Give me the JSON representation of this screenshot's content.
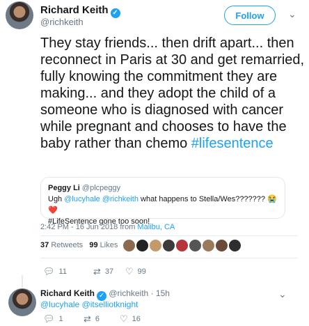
{
  "tweet": {
    "author_name": "Richard Keith",
    "author_handle": "@richkeith",
    "follow_label": "Follow",
    "text_main": "They stay friends... then drift apart... then reconnect in Paris at 30 and get remarried, fully knowing the commitment they are making... and they adopt the child of a someone who is diagnosed with cancer while pregnant and chooses to have the baby rather than chemo ",
    "hashtag": "#lifesentence",
    "quote": {
      "author_name": "Peggy Li",
      "author_handle": "@plcpeggy",
      "line1_prefix": "Ugh ",
      "mention1": "@lucyhale",
      "mention2": "@richkeith",
      "line1_suffix": " what happens to Stella/Wes??????? 😭❤️",
      "line2": "#LifeSentence gone too soon!"
    },
    "timestamp": "2:42 PM - 16 Jun 2018 from ",
    "location": "Malibu, CA",
    "retweets_count": "37",
    "retweets_label": "Retweets",
    "likes_count": "99",
    "likes_label": "Likes",
    "actions": {
      "replies": "11",
      "retweets": "37",
      "likes": "99"
    }
  },
  "reply": {
    "author_name": "Richard Keith",
    "author_handle": "@richkeith",
    "time": "15h",
    "mention1": "@lucyhale",
    "mention2": "@itselliotknight",
    "actions": {
      "replies": "1",
      "retweets": "6",
      "likes": "16"
    }
  },
  "colors": {
    "accent": "#1da1f2",
    "muted": "#657786",
    "text": "#14171a"
  },
  "icons": {
    "verified": "verified-badge-icon",
    "reply": "reply-icon",
    "retweet": "retweet-icon",
    "like": "heart-icon",
    "caret": "chevron-down-icon"
  }
}
